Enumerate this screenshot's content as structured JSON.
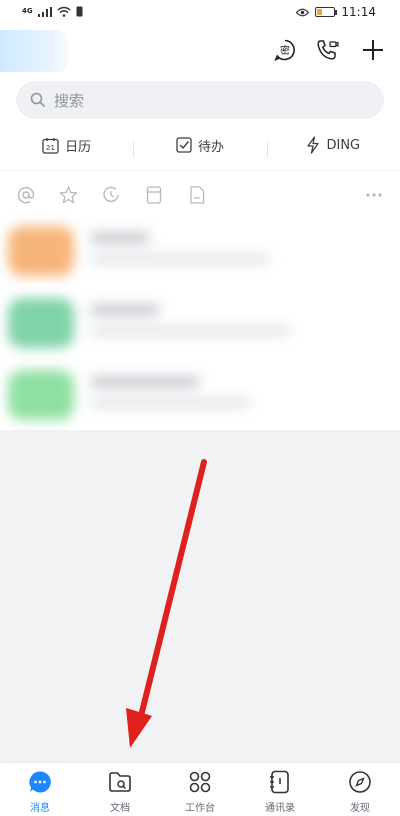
{
  "status_bar": {
    "network": "4G",
    "time": "11:14",
    "battery_level": 0.3
  },
  "header": {
    "icons": [
      "secret-chat-icon",
      "phone-call-icon",
      "plus-icon"
    ],
    "secret_label": "密"
  },
  "search": {
    "placeholder": "搜索"
  },
  "quick_actions": [
    {
      "label": "日历",
      "icon": "calendar-icon",
      "icon_text": "21"
    },
    {
      "label": "待办",
      "icon": "checkbox-icon"
    },
    {
      "label": "DING",
      "icon": "lightning-icon"
    }
  ],
  "filters": [
    "at-icon",
    "star-icon",
    "clock-icon",
    "card-icon",
    "document-icon",
    "more-icon"
  ],
  "tabs": [
    {
      "label": "消息",
      "icon": "message-icon",
      "active": true
    },
    {
      "label": "文档",
      "icon": "folder-icon"
    },
    {
      "label": "工作台",
      "icon": "workbench-icon"
    },
    {
      "label": "通讯录",
      "icon": "contacts-icon"
    },
    {
      "label": "发现",
      "icon": "discover-icon"
    }
  ],
  "colors": {
    "accent": "#1e86ff",
    "arrow": "#e0201c"
  }
}
